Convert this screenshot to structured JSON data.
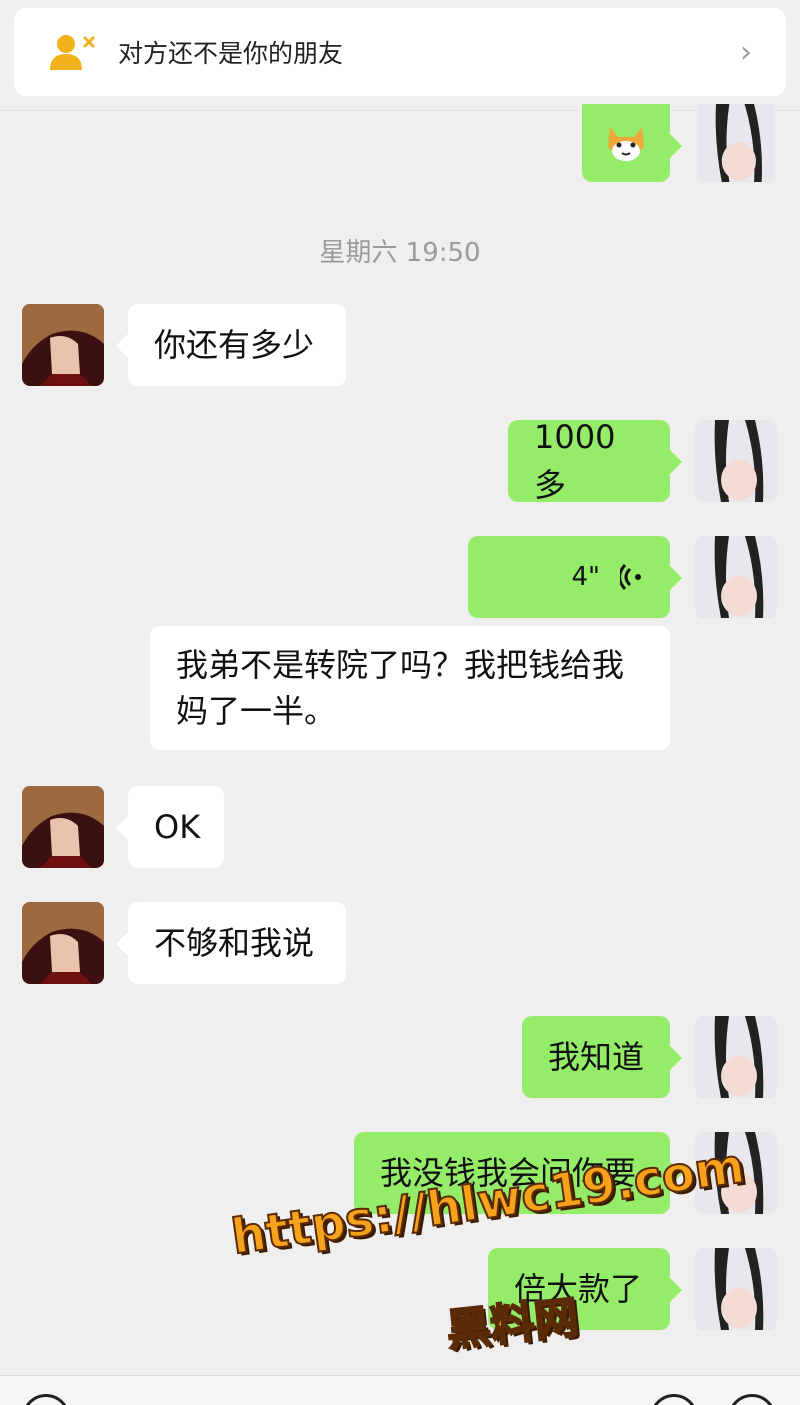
{
  "banner": {
    "text": "对方还不是你的朋友",
    "icon": "add-friend-icon",
    "chevron": "chevron-right-icon"
  },
  "timestamp": "星期六 19:50",
  "messages": [
    {
      "side": "right",
      "type": "sticker",
      "sticker": "shiba-dog-sticker"
    },
    {
      "side": "left",
      "type": "text",
      "text": "你还有多少"
    },
    {
      "side": "right",
      "type": "text",
      "text": "1000多"
    },
    {
      "side": "right",
      "type": "voice",
      "duration": "4\"",
      "icon": "voice-wave-icon"
    },
    {
      "side": "left",
      "type": "text",
      "text": "我弟不是转院了吗？我把钱给我妈了一半。"
    },
    {
      "side": "left",
      "type": "text",
      "text": "OK"
    },
    {
      "side": "left",
      "type": "text",
      "text": "不够和我说"
    },
    {
      "side": "right",
      "type": "text",
      "text": "我知道"
    },
    {
      "side": "right",
      "type": "text",
      "text": "我没钱我会问你要"
    },
    {
      "side": "right",
      "type": "text",
      "text": "倍大款了"
    }
  ],
  "watermark": {
    "line1": "https://hlwc19.com",
    "line2": "黑料网"
  },
  "colors": {
    "green_bubble": "#95ec69",
    "white_bubble": "#ffffff",
    "background": "#efefef"
  }
}
